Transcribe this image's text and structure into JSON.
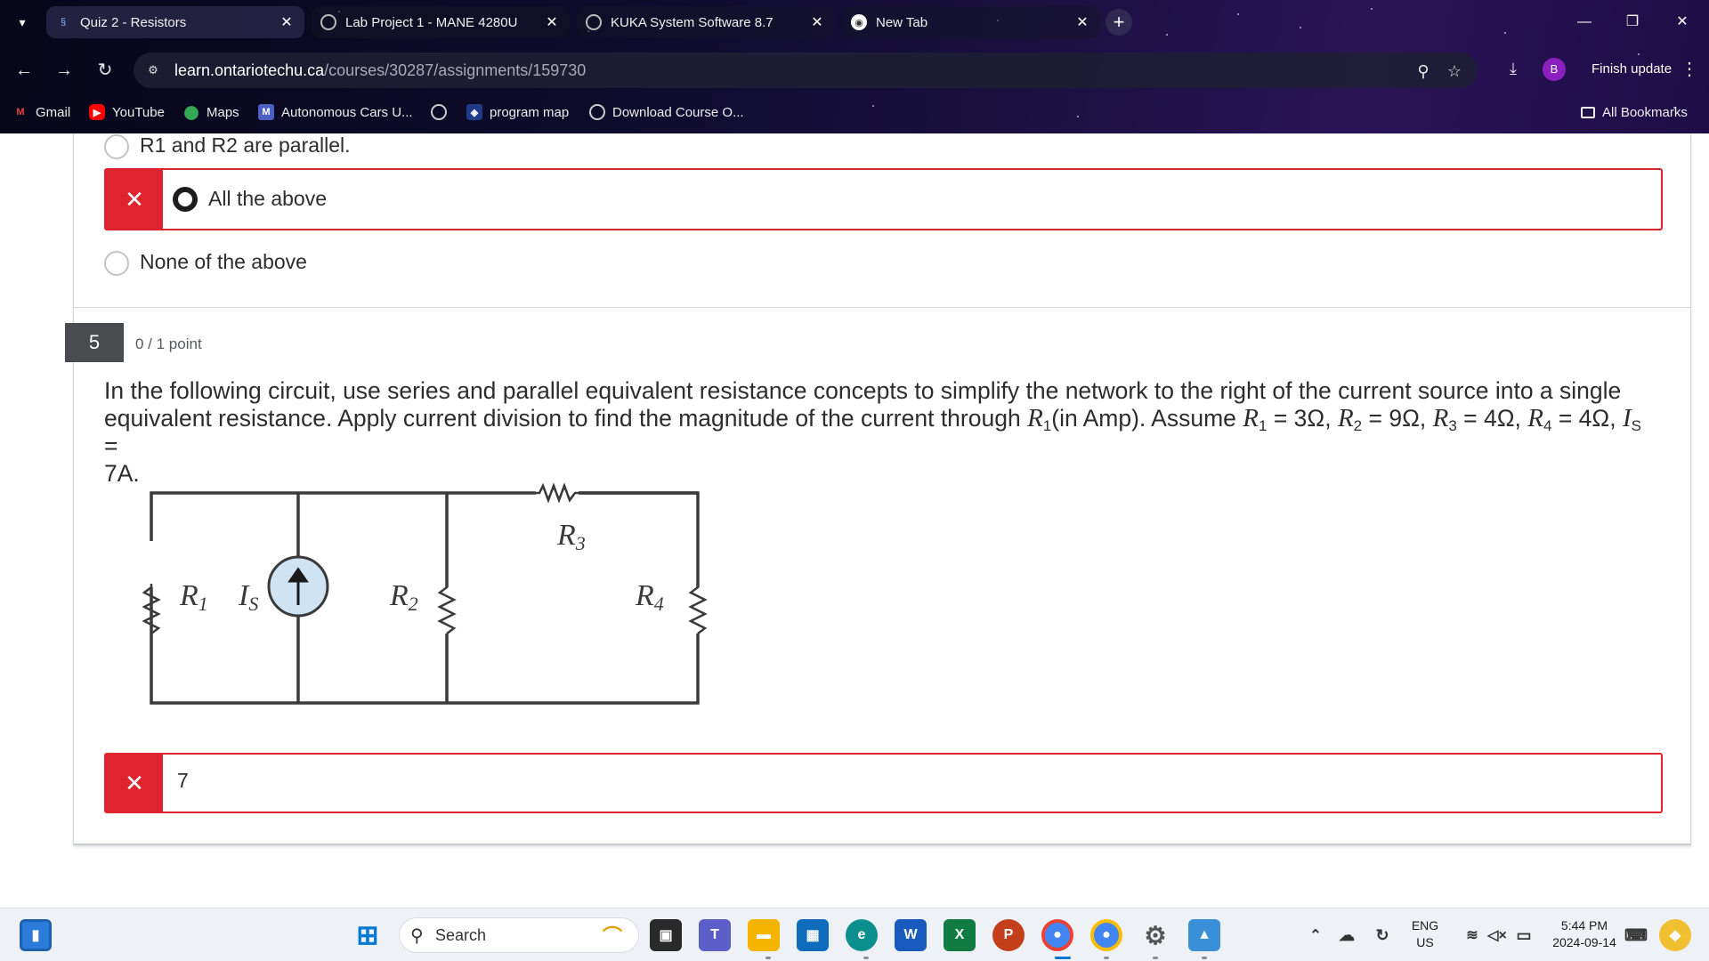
{
  "browser": {
    "tabs": [
      {
        "title": "Quiz 2 - Resistors",
        "active": true
      },
      {
        "title": "Lab Project 1 - MANE 4280U",
        "active": false
      },
      {
        "title": "KUKA System Software 8.7",
        "active": false
      },
      {
        "title": "New Tab",
        "active": false
      }
    ],
    "new_tab_symbol": "+",
    "url_domain": "learn.ontariotechu.ca",
    "url_path": "/courses/30287/assignments/159730",
    "profile_initial": "B",
    "finish_update_label": "Finish update",
    "bookmarks": [
      "Gmail",
      "YouTube",
      "Maps",
      "Autonomous Cars U...",
      "program map",
      "Download Course O..."
    ],
    "all_bookmarks_label": "All Bookmarks"
  },
  "quiz": {
    "prev_options": [
      {
        "label": "R1 and R2 are parallel.",
        "selected": false,
        "wrong": false
      },
      {
        "label": "All the above",
        "selected": true,
        "wrong": true
      },
      {
        "label": "None of the above",
        "selected": false,
        "wrong": false
      }
    ],
    "wrong_mark": "✕",
    "question_number": "5",
    "points": "0 / 1 point",
    "question_part1": "In the following circuit, use series and parallel equivalent resistance concepts to simplify the network to the right of the current source into a single equivalent resistance. Apply current division to find the magnitude of the current through ",
    "question_part2": "(in Amp). Assume ",
    "question_end": "7A.",
    "vars": {
      "R": "R",
      "I": "I",
      "sub1": "1",
      "sub2": "2",
      "sub3": "3",
      "sub4": "4",
      "subS": "S",
      "v1": " = 3Ω, ",
      "v2": " = 9Ω, ",
      "v3": " = 4Ω, ",
      "v4": " = 4Ω, ",
      "vS": " = "
    },
    "circuit_labels": {
      "r1": "R",
      "r1_sub": "1",
      "is": "I",
      "is_sub": "S",
      "r2": "R",
      "r2_sub": "2",
      "r3": "R",
      "r3_sub": "3",
      "r4": "R",
      "r4_sub": "4"
    },
    "answer_value": "7"
  },
  "taskbar": {
    "search_label": "Search",
    "lang_line1": "ENG",
    "lang_line2": "US",
    "time": "5:44 PM",
    "date": "2024-09-14"
  },
  "colors": {
    "wrong_red": "#e0242f",
    "question_number_bg": "#494c4e",
    "profile_purple": "#8c1fc0"
  }
}
